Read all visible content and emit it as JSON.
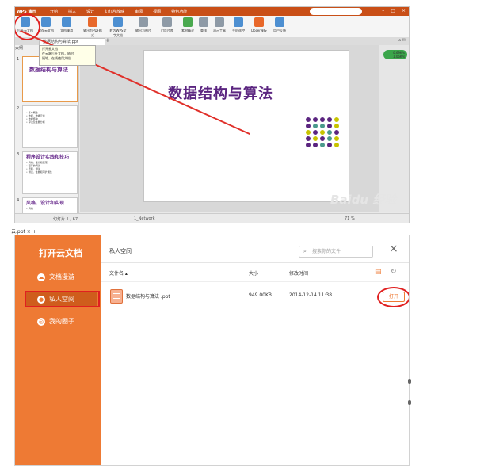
{
  "top_window": {
    "app_title": "WPS 演示",
    "menus": [
      "开始",
      "插入",
      "设计",
      "幻灯片放映",
      "审阅",
      "视图",
      "特色功能"
    ],
    "toolbar": [
      {
        "label": "打开云文档",
        "icon": "cloud-open-icon"
      },
      {
        "label": "保存云文档",
        "icon": "cloud-save-icon"
      },
      {
        "label": "文档漫游",
        "icon": "cloud-icon"
      },
      {
        "label": "输出为PDF格式",
        "icon": "pdf-icon"
      },
      {
        "label": "转为WPS文字文档",
        "icon": "convert-icon"
      },
      {
        "label": "输出为图片",
        "icon": "image-icon"
      },
      {
        "label": "幻灯片库",
        "icon": "slide-library-icon"
      },
      {
        "label": "素材精灵",
        "icon": "material-icon"
      },
      {
        "label": "重排",
        "icon": "rearrange-icon"
      },
      {
        "label": "演示工具",
        "icon": "tools-icon"
      },
      {
        "label": "手机遥控",
        "icon": "remote-icon"
      },
      {
        "label": "Docer模板",
        "icon": "docer-icon"
      },
      {
        "label": "用户反馈",
        "icon": "feedback-icon"
      }
    ],
    "doc_tab": "数据结构与算法.ppt",
    "tooltip_lines": [
      "打开云文档",
      "在云端打开文档，随时",
      "随地，在线使用文档"
    ],
    "thumb_tabs": "大纲",
    "thumbs": [
      {
        "num": "1",
        "title": "数据结构与算法"
      },
      {
        "num": "2",
        "lines": [
          "• 基本概念",
          "• 数据、数据元素",
          "• 数据结构",
          "• 算法及性能分析"
        ]
      },
      {
        "num": "3",
        "title": "程序设计实践和技巧",
        "lines": [
          "• 风格、设计和实现",
          "• 程序的调试",
          "• 界面、测试",
          "• 测试、性能和可扩展性"
        ]
      },
      {
        "num": "4",
        "title": "风格、设计和实现",
        "lines": [
          "• 风格"
        ]
      }
    ],
    "slide_title": "数据结构与算法",
    "speed": [
      "0.69K/s",
      "1.06K/s"
    ],
    "watermark": "Baidu 经验",
    "status": {
      "slide_info": "幻灯片 1 / 67",
      "theme": "1_Network",
      "zoom": "71 %"
    },
    "dot_colors": [
      "#5b2580",
      "#5b2580",
      "#5b2580",
      "#5b2580",
      "#c8c400",
      "#5b2580",
      "#4a9a8c",
      "#4a9a8c",
      "#5b2580",
      "#c8c400",
      "#c8c400",
      "#5b2580",
      "#c8c400",
      "#4a9a8c",
      "#5b2580",
      "#5b2580",
      "#c8c400",
      "#5b2580",
      "#4a9a8c",
      "#c8c400",
      "#5b2580",
      "#5b2580",
      "#4a9a8c",
      "#5b2580",
      "#c8c400"
    ]
  },
  "bottom_window": {
    "tabs_text": "云.ppt   ×   +",
    "sidebar_title": "打开云文档",
    "nav": [
      {
        "label": "文档漫游",
        "icon": "cloud-icon"
      },
      {
        "label": "私人空间",
        "icon": "person-icon"
      },
      {
        "label": "我的圈子",
        "icon": "circle-group-icon"
      }
    ],
    "panel_title": "私人空间",
    "search_placeholder": "搜索你的文件",
    "columns": {
      "name": "文件名 ▴",
      "size": "大小",
      "modified": "修改时间"
    },
    "files": [
      {
        "name": "数据结构与算法 .ppt",
        "size": "949.00KB",
        "modified": "2014-12-14 11:38",
        "action": "打开"
      }
    ]
  }
}
